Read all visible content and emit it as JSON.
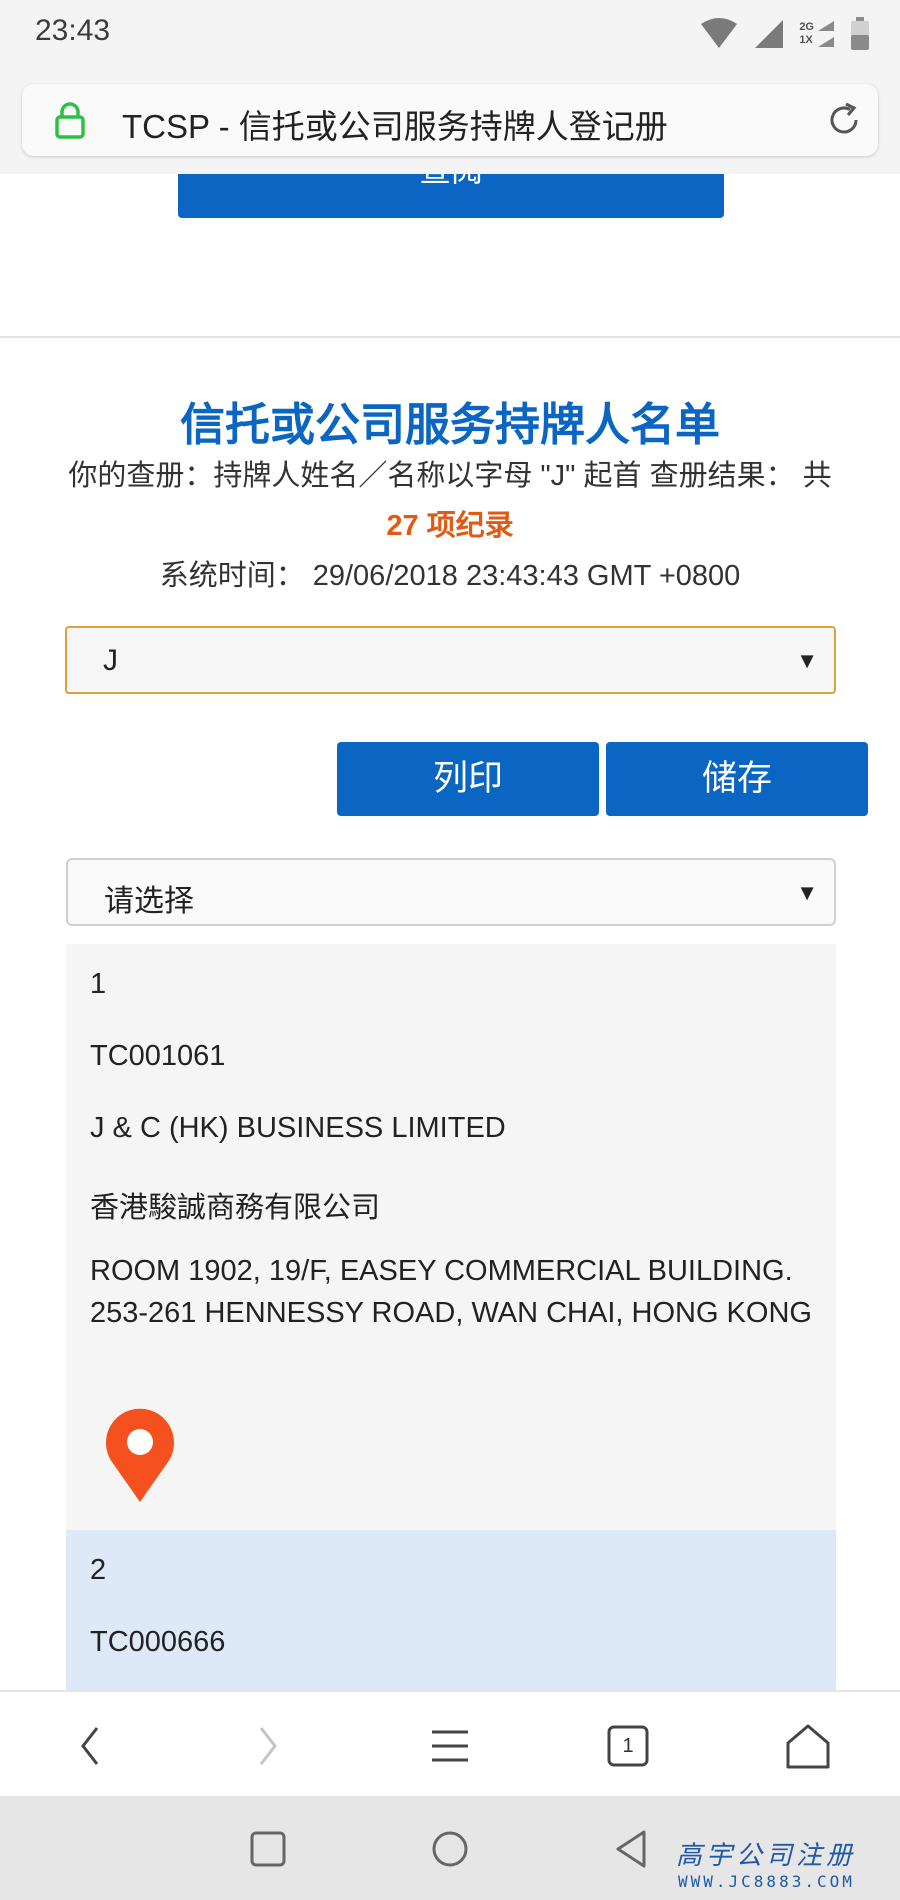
{
  "status_bar": {
    "time": "23:43",
    "network_top": "2G",
    "network_bottom": "1X"
  },
  "browser": {
    "page_title": "TCSP - 信托或公司服务持牌人登记册"
  },
  "search": {
    "button_label": "查阅"
  },
  "list": {
    "title": "信托或公司服务持牌人名单",
    "query_text": "你的查册：持牌人姓名／名称以字母 \"J\" 起首 查册结果： 共",
    "result_count": "27 项纪录",
    "system_time": "系统时间： 29/06/2018 23:43:43 GMT +0800"
  },
  "letter_select": {
    "value": "J"
  },
  "actions": {
    "print_label": "列印",
    "save_label": "储存"
  },
  "sort_select": {
    "value": "请选择"
  },
  "records": [
    {
      "index": "1",
      "licence_no": "TC001061",
      "name_en": "J & C (HK) BUSINESS LIMITED",
      "name_zh": "香港駿誠商務有限公司",
      "address_line1": "ROOM 1902, 19/F, EASEY COMMERCIAL BUILDING.",
      "address_line2": "253-261 HENNESSY ROAD, WAN CHAI, HONG KONG"
    },
    {
      "index": "2",
      "licence_no": "TC000666"
    }
  ],
  "browser_nav": {
    "tab_count": "1"
  },
  "watermark": {
    "text": "高宇公司注册",
    "url": "WWW.JC8883.COM"
  },
  "colors": {
    "accent": "#0a66c2",
    "highlight": "#e15a14",
    "pin": "#f4511e",
    "select_border": "#d9a23a"
  }
}
